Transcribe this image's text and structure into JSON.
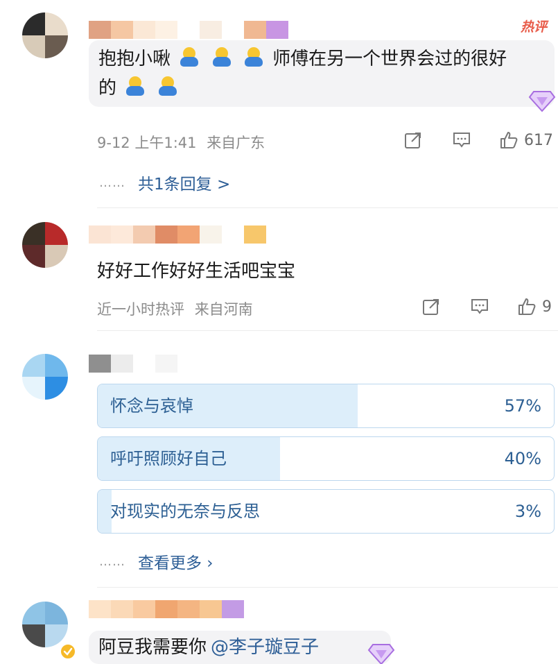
{
  "comments": [
    {
      "hot_badge": "热评",
      "text_a": "抱抱小啾",
      "text_b": "师傅在另一个世界会过的很好",
      "text_c": "的",
      "time": "9-12 上午1:41",
      "location": "来自广东",
      "likes": "617",
      "replies_link": "共1条回复 >",
      "replies_dots": "……"
    },
    {
      "text": "好好工作好好生活吧宝宝",
      "time": "近一小时热评",
      "location": "来自河南",
      "likes": "9"
    }
  ],
  "poll": {
    "options": [
      {
        "label": "怀念与哀悼",
        "percent_text": "57%",
        "percent": 57
      },
      {
        "label": "呼吁照顾好自己",
        "percent_text": "40%",
        "percent": 40
      },
      {
        "label": "对现实的无奈与反思",
        "percent_text": "3%",
        "percent": 3
      }
    ],
    "more_link": "查看更多 ›",
    "more_dots": "……"
  },
  "last_comment": {
    "text": "阿豆我需要你",
    "mention": "@李子璇豆子"
  },
  "colors": {
    "link": "#2d5e96",
    "poll_border": "#bcd7ee",
    "poll_fill": "#ddeefa",
    "hot_badge": "#e85c4a"
  },
  "icons": [
    "repost-icon",
    "comment-icon",
    "like-icon",
    "gem-icon",
    "verified-badge-icon",
    "emoji-hug-icon"
  ]
}
